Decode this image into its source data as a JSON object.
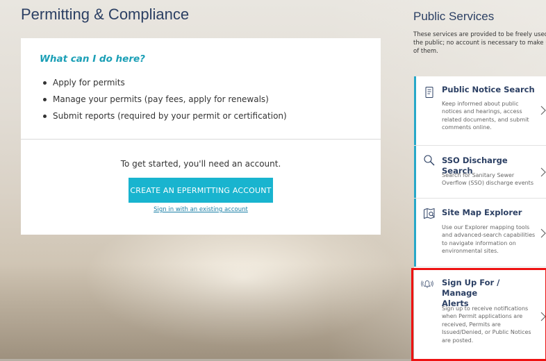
{
  "page": {
    "title": "Permitting & Compliance"
  },
  "card": {
    "heading": "What can I do here?",
    "actions": [
      "Apply for permits",
      "Manage your permits (pay fees, apply for renewals)",
      "Submit reports (required by your permit or certification)"
    ],
    "get_started": "To get started, you'll need an account.",
    "create_button": "CREATE AN EPERMITTING ACCOUNT",
    "signin_link": "Sign in with an existing account"
  },
  "sidebar": {
    "title": "Public Services",
    "description_lines": [
      "These services are provided to be freely used",
      "the public; no account is necessary to make u",
      "of them."
    ],
    "services": [
      {
        "icon": "document-icon",
        "title_lines": [
          "Public Notice Search"
        ],
        "desc_lines": [
          "Keep informed about public",
          "notices and hearings, access",
          "related documents, and submit",
          "comments online."
        ]
      },
      {
        "icon": "search-icon",
        "title_lines": [
          "SSO Discharge Search"
        ],
        "desc_lines": [
          "Search for Sanitary Sewer",
          "Overflow (SSO) discharge events"
        ]
      },
      {
        "icon": "map-search-icon",
        "title_lines": [
          "Site Map Explorer"
        ],
        "desc_lines": [
          "Use our Explorer mapping tools",
          "and advanced-search capabilities",
          "to navigate information on",
          "environmental sites."
        ]
      },
      {
        "icon": "alert-bell-icon",
        "title_lines": [
          "Sign Up For / Manage",
          "Alerts"
        ],
        "desc_lines": [
          "Sign up to receive notifications",
          "when Permit applications are",
          "received, Permits are",
          "Issued/Denied, or Public Notices",
          "are posted."
        ]
      }
    ]
  },
  "colors": {
    "title": "#2b3f63",
    "accent_teal": "#19b4cf",
    "heading_teal": "#1b9fb6",
    "highlight_red": "#ee1111"
  }
}
